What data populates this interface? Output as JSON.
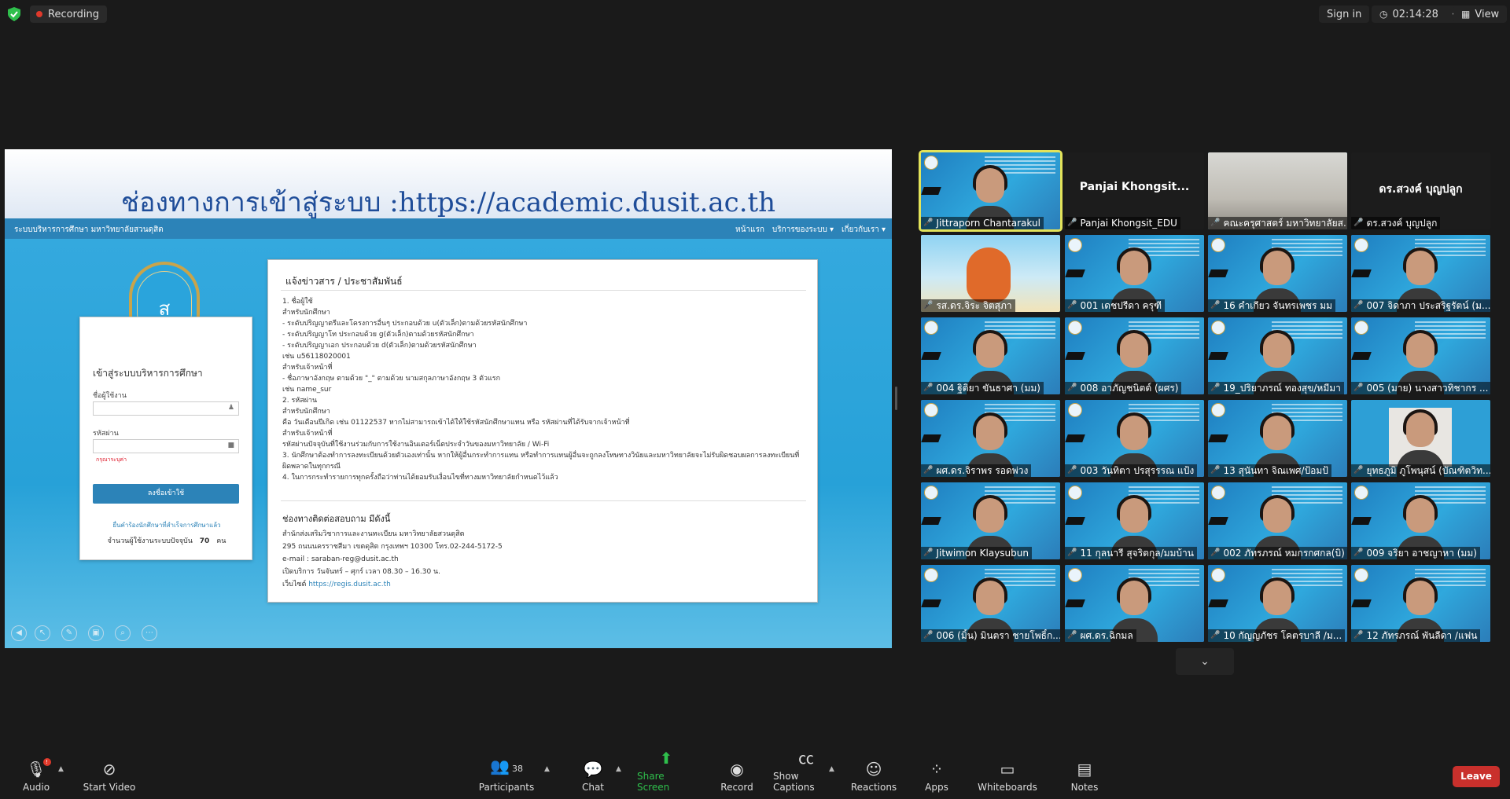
{
  "top": {
    "recording_label": "Recording",
    "sign_in": "Sign in",
    "timer": "02:14:28",
    "view": "View"
  },
  "shared_screen": {
    "banner_title": "ช่องทางการเข้าสู่ระบบ :https://academic.dusit.ac.th",
    "navbar_title": "ระบบบริหารการศึกษา มหาวิทยาลัยสวนดุสิต",
    "navbar_items": [
      "หน้าแรก",
      "บริการของระบบ ▾",
      "เกี่ยวกับเรา ▾"
    ],
    "logo_text": "SUAN DUSIT UNIVERSITY",
    "login": {
      "title": "เข้าสู่ระบบบริหารการศึกษา",
      "username_label": "ชื่อผู้ใช้งาน",
      "password_label": "รหัสผ่าน",
      "required_note": "กรุณาระบุค่า",
      "submit": "ลงชื่อเข้าใช้",
      "forgot_link": "ยื่นคำร้องนักศึกษาที่สำเร็จการศึกษาแล้ว",
      "online_count_label": "จำนวนผู้ใช้งานระบบปัจจุบัน",
      "online_count": "70",
      "online_unit": "คน"
    },
    "news": {
      "heading": "แจ้งข่าวสาร / ประชาสัมพันธ์",
      "lines": [
        "1. ชื่อผู้ใช้",
        "     สำหรับนักศึกษา",
        "        - ระดับปริญญาตรีและโครงการอื่นๆ ประกอบด้วย u(ตัวเล็ก)ตามด้วยรหัสนักศึกษา",
        "        - ระดับปริญญาโท ประกอบด้วย g(ตัวเล็ก)ตามด้วยรหัสนักศึกษา",
        "        - ระดับปริญญาเอก ประกอบด้วย d(ตัวเล็ก)ตามด้วยรหัสนักศึกษา",
        "        เช่น u56118020001",
        "     สำหรับเจ้าหน้าที่",
        "        - ชื่อภาษาอังกฤษ ตามด้วย \"_\" ตามด้วย นามสกุลภาษาอังกฤษ 3 ตัวแรก",
        "        เช่น name_sur",
        "2. รหัสผ่าน",
        "     สำหรับนักศึกษา",
        "        คือ วันเดือนปีเกิด เช่น 01122537 หากไม่สามารถเข้าได้ให้ใช้รหัสนักศึกษาแทน หรือ รหัสผ่านที่ได้รับจากเจ้าหน้าที่",
        "     สำหรับเจ้าหน้าที่",
        "        รหัสผ่านปัจจุบันที่ใช้งานร่วมกับการใช้งานอินเตอร์เน็ตประจำวันของมหาวิทยาลัย / Wi-Fi",
        "3. นักศึกษาต้องทำการลงทะเบียนด้วยตัวเองเท่านั้น หากให้ผู้อื่นกระทำการแทน หรือทำการแทนผู้อื่นจะถูกลงโทษทางวินัยและมหาวิทยาลัยจะไม่รับผิดชอบผลการลงทะเบียนที่",
        "ผิดพลาดในทุกกรณี",
        "4. ในการกระทำรายการทุกครั้งถือว่าท่านได้ยอมรับเงื่อนไขที่ทางมหาวิทยาลัยกำหนดไว้แล้ว"
      ],
      "contact_heading": "ช่องทางติดต่อสอบถาม มีดังนี้",
      "contact_lines": [
        "สำนักส่งเสริมวิชาการและงานทะเบียน มหาวิทยาลัยสวนดุสิต",
        "295 ถนนนครราชสีมา เขตดุสิต กรุงเทพฯ 10300  โทร.02-244-5172-5",
        "e-mail : saraban-reg@dusit.ac.th",
        "เปิดบริการ วันจันทร์ – ศุกร์ เวลา 08.30 – 16.30 น."
      ],
      "website_label": "เว็บไซต์",
      "website_url": "https://regis.dusit.ac.th"
    }
  },
  "participants_tiles": [
    {
      "name": "Jittraporn Chantarakul",
      "type": "cam-active"
    },
    {
      "name": "Panjai Khongsit_EDU",
      "big_name": "Panjai  Khongsit...",
      "type": "name-only"
    },
    {
      "name": "คณะครุศาสตร์ มหาวิทยาลัยส...",
      "type": "room"
    },
    {
      "name": "ดร.สวงค์ บุญปลูก",
      "big_name": "ดร.สวงค์ บุญปลูก",
      "type": "name-only"
    },
    {
      "name": "รส.ดร.จิระ จิตสุภา",
      "type": "fox"
    },
    {
      "name": "001 เดชปรีดา ครุฑี",
      "type": "cam"
    },
    {
      "name": "16 คำเกียว จันทรเพชร มม",
      "type": "cam"
    },
    {
      "name": "007 จิดาภา ประสริฐรัตน์ (ม...",
      "type": "cam"
    },
    {
      "name": "004 ฐิติยา ขันธาศา (มม)",
      "type": "cam"
    },
    {
      "name": "008 อาภัญชนิตต์ (ผศร)",
      "type": "cam"
    },
    {
      "name": "19_ปริยาภรณ์ ทองสุข/หมีมา",
      "type": "cam"
    },
    {
      "name": "005 (มาย) นางสาวทิชากร ...",
      "type": "cam"
    },
    {
      "name": "ผศ.ดร.จิราพร รอดพ่วง",
      "type": "cam"
    },
    {
      "name": "003 วันทิตา ปรสุรรรณ แป้ง",
      "type": "cam"
    },
    {
      "name": "13 สุนันทา จิณเพศ/ป้อมป้",
      "type": "cam"
    },
    {
      "name": "ยุทธภูมิ ภูโพนุสน์ (บัณฑิตวิท...",
      "type": "photo"
    },
    {
      "name": "Jitwimon Klaysubun",
      "type": "cam"
    },
    {
      "name": "11 กุลนารี สุจริตกุล/มมบ้าน",
      "type": "cam"
    },
    {
      "name": "002 ภัทรภรณ์ หมกรกศกล(บิ)",
      "type": "cam"
    },
    {
      "name": "009 จริยา อาชญาหา (มม)",
      "type": "cam"
    },
    {
      "name": "006 (มิ้น) มินตรา ชายโพธิ์ก...",
      "type": "cam"
    },
    {
      "name": "ผศ.ดร.ฉิกมล",
      "type": "cam"
    },
    {
      "name": "10 กัญญภัชร โคตรบาลี /ม...",
      "type": "cam"
    },
    {
      "name": "12 ภัทรภรณ์ พันลีดา /แฟน",
      "type": "cam"
    }
  ],
  "toolbar": {
    "audio": "Audio",
    "audio_badge": "!",
    "start_video": "Start Video",
    "participants": "Participants",
    "participants_count": "38",
    "chat": "Chat",
    "share_screen": "Share Screen",
    "record": "Record",
    "captions": "Show Captions",
    "reactions": "Reactions",
    "apps": "Apps",
    "whiteboards": "Whiteboards",
    "notes": "Notes",
    "leave": "Leave"
  },
  "colors": {
    "share_green": "#2fbf4c",
    "leave_red": "#c9302c",
    "active_speaker": "#e3e35a",
    "recording_dot": "#e0392b"
  }
}
